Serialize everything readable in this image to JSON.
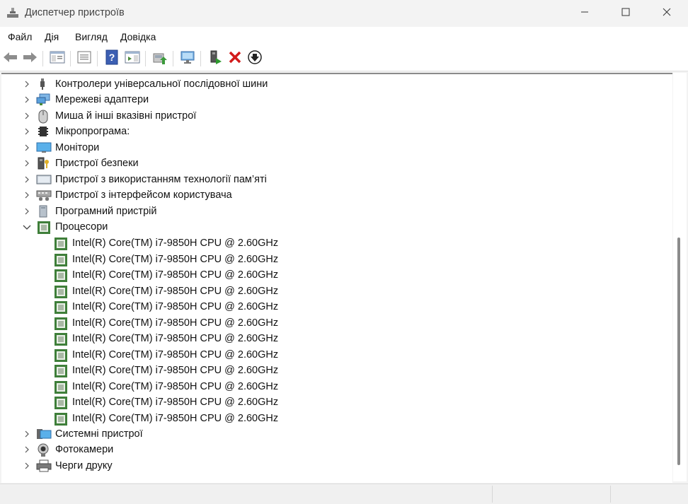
{
  "window": {
    "title": "Диспетчер пристроїв",
    "icon": "device-manager-icon",
    "controls": [
      "minimize-icon",
      "maximize-icon",
      "close-icon"
    ]
  },
  "menu": [
    "Файл",
    "Дія",
    "Вигляд",
    "Довідка"
  ],
  "toolbar": {
    "buttons": [
      "back-icon",
      "forward-icon",
      "show-hide-tree-icon",
      "properties-icon",
      "help-icon",
      "action-pane-icon",
      "update-driver-icon",
      "scan-hardware-icon",
      "enable-device-icon",
      "uninstall-device-icon",
      "disable-device-icon"
    ]
  },
  "tree": {
    "categories_above": [
      {
        "label": "Контролери універсальної послідовної шини",
        "icon": "usb-icon"
      },
      {
        "label": "Мережеві адаптери",
        "icon": "network-adapter-icon"
      },
      {
        "label": "Миша й інші вказівні пристрої",
        "icon": "mouse-icon"
      },
      {
        "label": "Мікропрограма:",
        "icon": "firmware-icon"
      },
      {
        "label": "Монітори",
        "icon": "monitor-icon"
      },
      {
        "label": "Пристрої безпеки",
        "icon": "security-device-icon"
      },
      {
        "label": "Пристрої з використанням технології пам’яті",
        "icon": "memory-device-icon"
      },
      {
        "label": "Пристрої з інтерфейсом користувача",
        "icon": "hid-icon"
      },
      {
        "label": "Програмний пристрій",
        "icon": "software-device-icon"
      }
    ],
    "expanded": {
      "label": "Процесори",
      "icon": "processor-icon",
      "children": [
        "Intel(R) Core(TM) i7-9850H CPU @ 2.60GHz",
        "Intel(R) Core(TM) i7-9850H CPU @ 2.60GHz",
        "Intel(R) Core(TM) i7-9850H CPU @ 2.60GHz",
        "Intel(R) Core(TM) i7-9850H CPU @ 2.60GHz",
        "Intel(R) Core(TM) i7-9850H CPU @ 2.60GHz",
        "Intel(R) Core(TM) i7-9850H CPU @ 2.60GHz",
        "Intel(R) Core(TM) i7-9850H CPU @ 2.60GHz",
        "Intel(R) Core(TM) i7-9850H CPU @ 2.60GHz",
        "Intel(R) Core(TM) i7-9850H CPU @ 2.60GHz",
        "Intel(R) Core(TM) i7-9850H CPU @ 2.60GHz",
        "Intel(R) Core(TM) i7-9850H CPU @ 2.60GHz",
        "Intel(R) Core(TM) i7-9850H CPU @ 2.60GHz"
      ]
    },
    "categories_below": [
      {
        "label": "Системні пристрої",
        "icon": "system-device-icon"
      },
      {
        "label": "Фотокамери",
        "icon": "camera-icon"
      },
      {
        "label": "Черги друку",
        "icon": "printer-icon"
      }
    ]
  }
}
